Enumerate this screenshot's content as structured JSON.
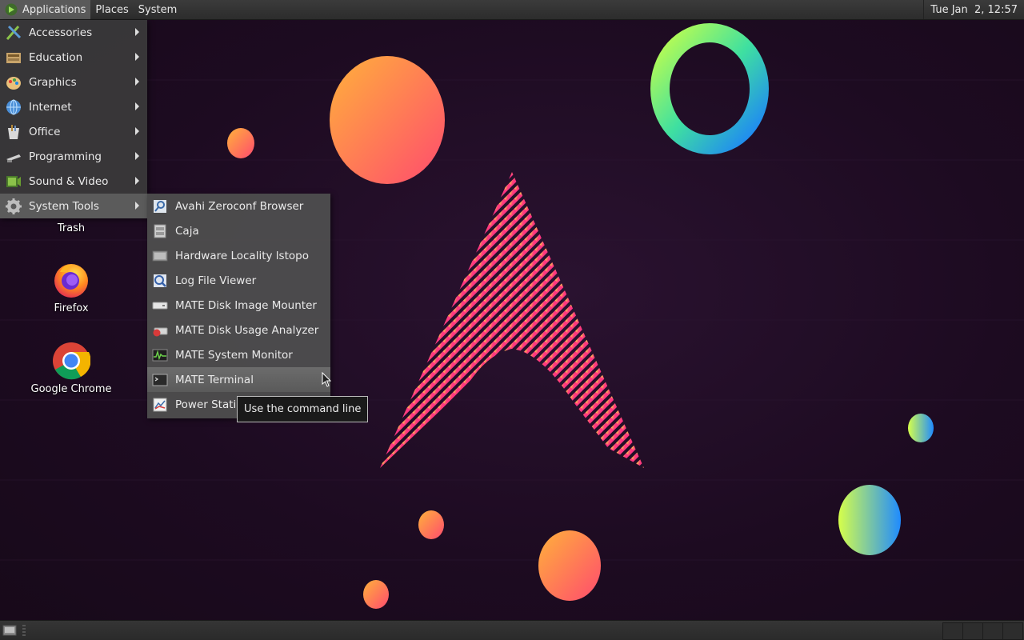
{
  "top_panel": {
    "menus": [
      {
        "label": "Applications",
        "active": true
      },
      {
        "label": "Places",
        "active": false
      },
      {
        "label": "System",
        "active": false
      }
    ],
    "clock": "Tue Jan  2, 12:57"
  },
  "desktop": {
    "icons": [
      {
        "label": "Trash",
        "icon": "trash-icon"
      },
      {
        "label": "Firefox",
        "icon": "firefox-icon"
      },
      {
        "label": "Google Chrome",
        "icon": "chrome-icon"
      }
    ]
  },
  "applications_menu": {
    "items": [
      {
        "label": "Accessories",
        "icon": "accessories-icon",
        "selected": false
      },
      {
        "label": "Education",
        "icon": "education-icon",
        "selected": false
      },
      {
        "label": "Graphics",
        "icon": "graphics-icon",
        "selected": false
      },
      {
        "label": "Internet",
        "icon": "internet-icon",
        "selected": false
      },
      {
        "label": "Office",
        "icon": "office-icon",
        "selected": false
      },
      {
        "label": "Programming",
        "icon": "programming-icon",
        "selected": false
      },
      {
        "label": "Sound & Video",
        "icon": "sound-video-icon",
        "selected": false
      },
      {
        "label": "System Tools",
        "icon": "system-tools-icon",
        "selected": true
      }
    ]
  },
  "system_tools_menu": {
    "items": [
      {
        "label": "Avahi Zeroconf Browser",
        "icon": "avahi-icon",
        "selected": false
      },
      {
        "label": "Caja",
        "icon": "file-manager-icon",
        "selected": false
      },
      {
        "label": "Hardware Locality lstopo",
        "icon": "hardware-icon",
        "selected": false
      },
      {
        "label": "Log File Viewer",
        "icon": "log-viewer-icon",
        "selected": false
      },
      {
        "label": "MATE Disk Image Mounter",
        "icon": "disk-mounter-icon",
        "selected": false
      },
      {
        "label": "MATE Disk Usage Analyzer",
        "icon": "disk-usage-icon",
        "selected": false
      },
      {
        "label": "MATE System Monitor",
        "icon": "system-monitor-icon",
        "selected": false
      },
      {
        "label": "MATE Terminal",
        "icon": "terminal-icon",
        "selected": true
      },
      {
        "label": "Power Statistics",
        "icon": "power-statistics-icon",
        "selected": false
      }
    ]
  },
  "tooltip": {
    "text": "Use the command line"
  },
  "colors": {
    "panel": "#2c2c2c",
    "menu_bg": "#3a3a3a",
    "selected": "#5b5b5b",
    "wallpaper": "#1f0d22"
  }
}
